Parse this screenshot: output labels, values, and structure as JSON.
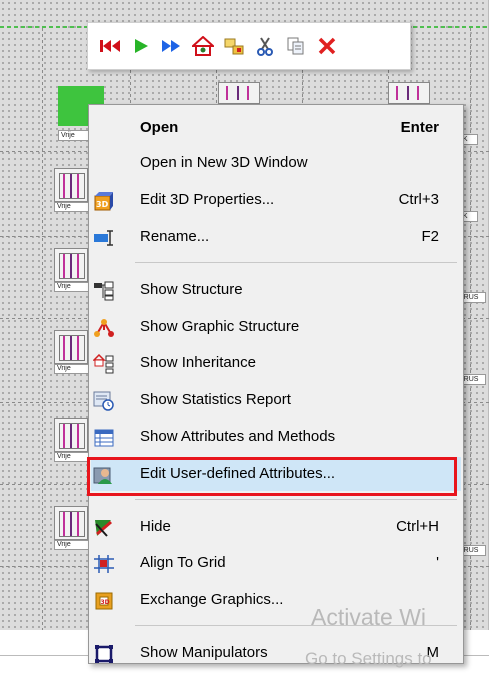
{
  "canvas": {
    "nodes": [
      {
        "label": "Vrije"
      },
      {
        "label": "Vrije"
      },
      {
        "label": "Vrije"
      },
      {
        "label": "Vrije"
      },
      {
        "label": "Vrije"
      }
    ],
    "top_node_label": "Vrije",
    "side_labels": [
      "3K",
      "3K",
      "BRUS",
      "BRUS",
      "BRUS"
    ]
  },
  "toolbar": {
    "buttons": [
      {
        "name": "skip-first-icon"
      },
      {
        "name": "play-icon"
      },
      {
        "name": "fast-forward-icon"
      },
      {
        "name": "home-graphic-icon"
      },
      {
        "name": "folder-open-icon"
      },
      {
        "name": "cut-icon"
      },
      {
        "name": "copy-icon"
      },
      {
        "name": "delete-icon"
      }
    ]
  },
  "menu": {
    "items": [
      {
        "label": "Open",
        "shortcut": "Enter"
      },
      {
        "label": "Open in New 3D Window",
        "shortcut": ""
      },
      {
        "label": "Edit 3D Properties...",
        "shortcut": "Ctrl+3"
      },
      {
        "label": "Rename...",
        "shortcut": "F2"
      },
      {
        "label": "Show Structure",
        "shortcut": ""
      },
      {
        "label": "Show Graphic Structure",
        "shortcut": ""
      },
      {
        "label": "Show Inheritance",
        "shortcut": ""
      },
      {
        "label": "Show Statistics Report",
        "shortcut": ""
      },
      {
        "label": "Show Attributes and Methods",
        "shortcut": ""
      },
      {
        "label": "Edit User-defined Attributes...",
        "shortcut": ""
      },
      {
        "label": "Hide",
        "shortcut": "Ctrl+H"
      },
      {
        "label": "Align To Grid",
        "shortcut": "'"
      },
      {
        "label": "Exchange Graphics...",
        "shortcut": ""
      },
      {
        "label": "Show Manipulators",
        "shortcut": "M"
      }
    ]
  },
  "watermark": {
    "line1": "Activate Wi",
    "line2": "Go to Settings to"
  },
  "colors": {
    "highlight_border": "#e8141c",
    "highlight_fill": "#cfe6f7",
    "menu_bg": "#f0f0f0"
  }
}
